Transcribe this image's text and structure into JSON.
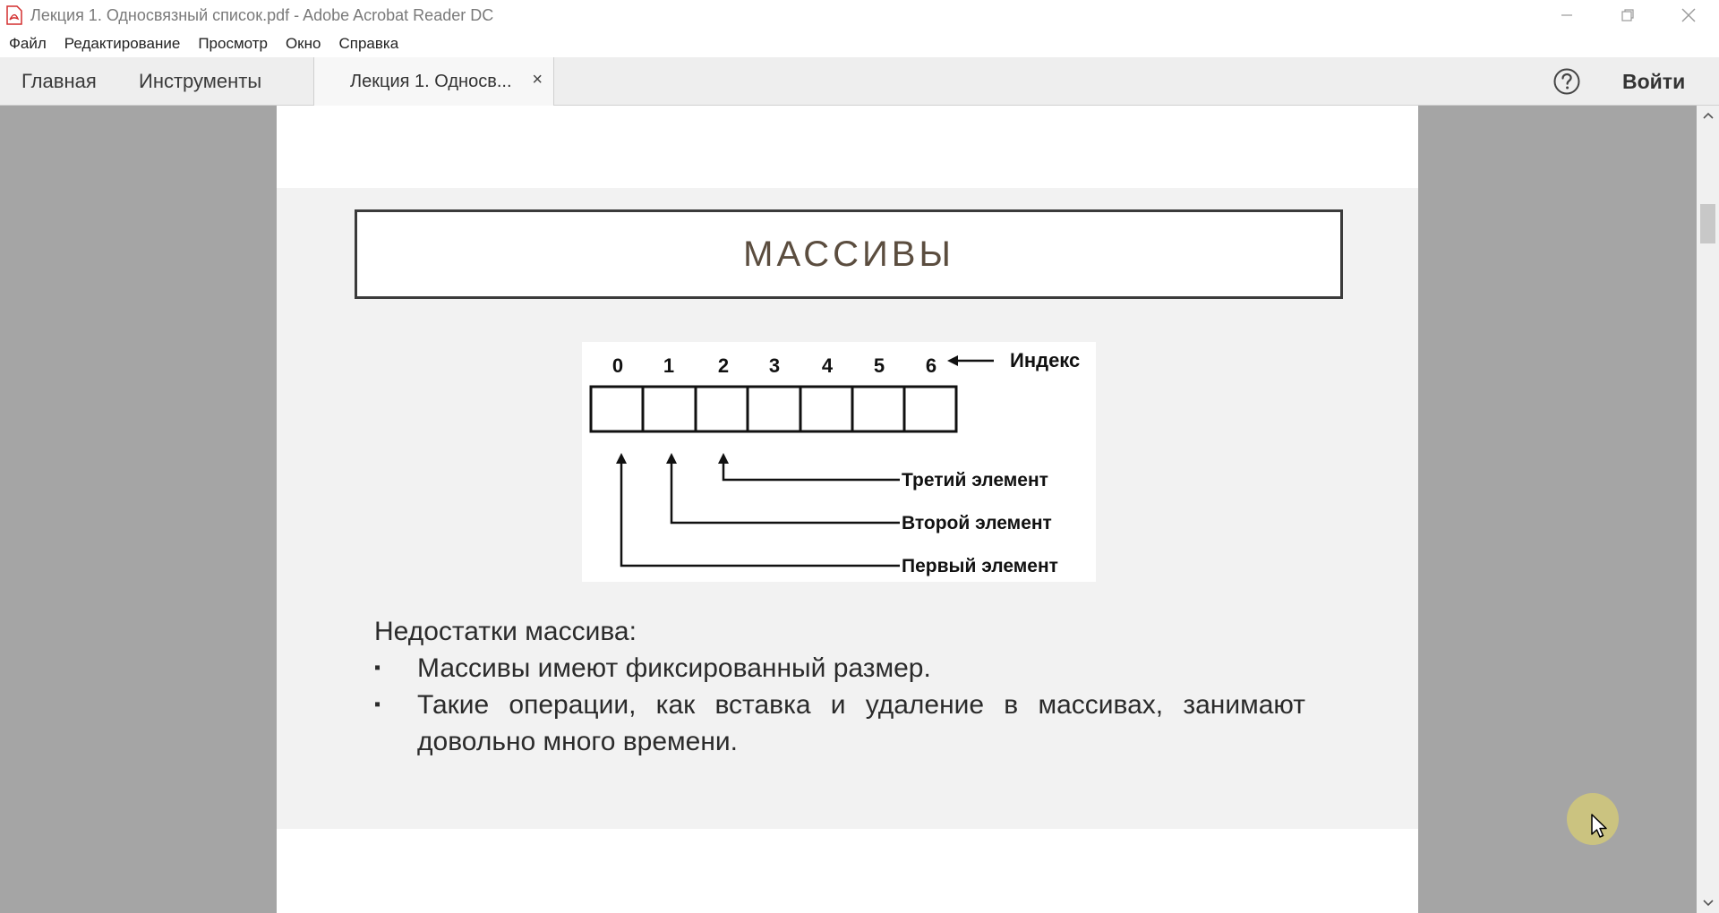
{
  "window": {
    "title": "Лекция 1. Односвязный список.pdf - Adobe Acrobat Reader DC",
    "app_icon": "acrobat-pdf-icon",
    "controls": [
      "minimize-icon",
      "restore-icon",
      "close-icon"
    ]
  },
  "menu": {
    "items": [
      "Файл",
      "Редактирование",
      "Просмотр",
      "Окно",
      "Справка"
    ]
  },
  "toolbar": {
    "home": "Главная",
    "tools": "Инструменты",
    "doc_tab": "Лекция 1. Односв...",
    "doc_tab_close": "×",
    "help_icon": "help-circle-icon",
    "signin": "Войти"
  },
  "slide": {
    "title": "МАССИВЫ",
    "diagram": {
      "indices": [
        "0",
        "1",
        "2",
        "3",
        "4",
        "5",
        "6"
      ],
      "index_label": "Индекс",
      "labels": [
        "Третий элемент",
        "Второй элемент",
        "Первый элемент"
      ]
    },
    "notes": {
      "heading": "Недостатки массива:",
      "bullet_char": "▪",
      "bullets": [
        "Массивы имеют фиксированный размер.",
        "Такие операции, как вставка и удаление в массивах, занимают довольно много времени."
      ]
    }
  },
  "colors": {
    "viewport_bg": "#a5a5a5",
    "slide_bg": "#f2f2f2",
    "title_text": "#5b4d3f",
    "cursor_highlight": "#cfc77c"
  }
}
